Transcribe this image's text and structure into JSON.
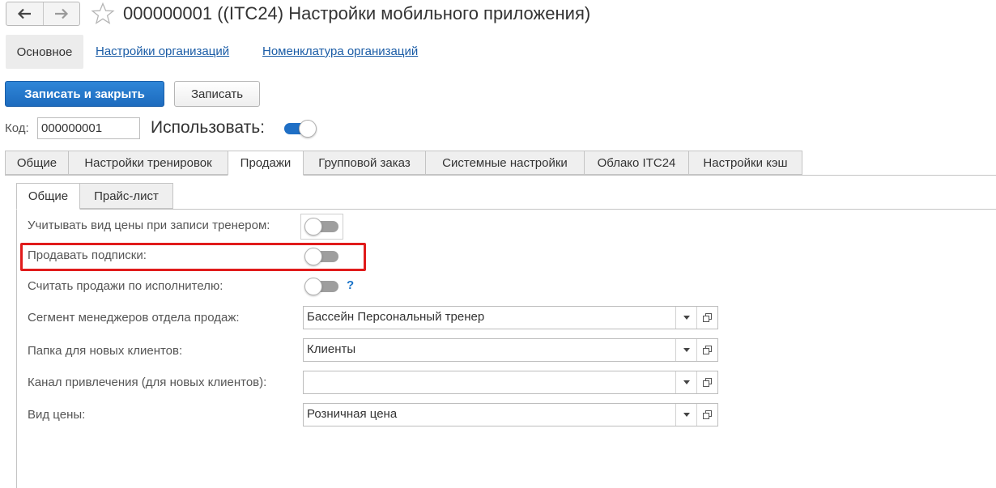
{
  "header": {
    "back_icon": "arrow-left-icon",
    "forward_icon": "arrow-right-icon",
    "favorite_icon": "star-icon",
    "title": "000000001 ((ITC24) Настройки мобильного приложения)"
  },
  "sections": {
    "active": "Основное",
    "links": [
      "Настройки организаций",
      "Номенклатура организаций"
    ]
  },
  "commands": {
    "save_close": "Записать и закрыть",
    "save": "Записать"
  },
  "form": {
    "kod_label": "Код:",
    "kod_value": "000000001",
    "use_label": "Использовать:",
    "use_on": true
  },
  "tabs": [
    "Общие",
    "Настройки тренировок",
    "Продажи",
    "Групповой заказ",
    "Системные настройки",
    "Облако ITC24",
    "Настройки кэш"
  ],
  "active_tab": "Продажи",
  "subtabs": [
    "Общие",
    "Прайс-лист"
  ],
  "active_subtab": "Общие",
  "settings": {
    "price_type_trainer": {
      "label": "Учитывать вид цены при записи тренером:",
      "on": false
    },
    "sell_subscriptions": {
      "label": "Продавать подписки:",
      "on": false
    },
    "count_by_executor": {
      "label": "Считать продажи по исполнителю:",
      "on": false,
      "help": "?"
    },
    "manager_segment": {
      "label": "Сегмент менеджеров отдела продаж:",
      "value": "Бассейн Персональный тренер"
    },
    "new_clients_folder": {
      "label": "Папка для новых клиентов:",
      "value": "Клиенты"
    },
    "acquisition_channel": {
      "label": "Канал привлечения (для новых клиентов):",
      "value": ""
    },
    "price_type": {
      "label": "Вид цены:",
      "value": "Розничная цена"
    }
  },
  "colors": {
    "accent": "#1f6fc5",
    "highlight": "#e01b1b",
    "link": "#1a5ca6"
  }
}
